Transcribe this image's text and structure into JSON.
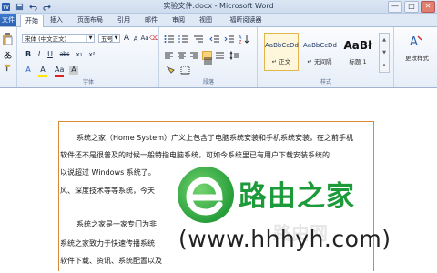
{
  "window": {
    "title": "实验文件.docx - Microsoft Word",
    "controls": [
      "—",
      "□",
      "✕"
    ]
  },
  "quick_access": {
    "icons": [
      "word-icon",
      "save-icon",
      "undo-icon",
      "redo-icon"
    ]
  },
  "tabs": {
    "file": "文件",
    "items": [
      "开始",
      "插入",
      "页面布局",
      "引用",
      "邮件",
      "审阅",
      "视图",
      "福昕阅读器"
    ],
    "active_index": 0
  },
  "ribbon": {
    "font": {
      "name": "宋体 (中文正文)",
      "size": "五号",
      "label": "字体",
      "buttons_row1": [
        "A",
        "A",
        "Aa",
        "⌫",
        "文"
      ],
      "buttons_row2": [
        "B",
        "I",
        "U",
        "abc",
        "x₂",
        "x²"
      ],
      "buttons_row3": [
        "A",
        "A",
        "Aa",
        "A"
      ]
    },
    "paragraph": {
      "label": "段落",
      "alignment_active": "justify"
    },
    "styles": {
      "label": "样式",
      "items": [
        {
          "sample": "AaBbCcDd",
          "name": "↵ 正文",
          "active": true
        },
        {
          "sample": "AaBbCcDd",
          "name": "↵ 无间隔",
          "active": false
        },
        {
          "sample": "AaBł",
          "name": "标题 1",
          "active": false
        }
      ],
      "change_styles": "更改样式",
      "change_styles_icon": "change-styles-icon"
    }
  },
  "document": {
    "lines": [
      "系统之家（Home System）广义上包含了电脑系统安装和手机系统安装，在之前手机",
      "软件还不是很普及的时候一般特指电脑系统，可如今系统里已有用户下载安装系统的",
      "以说超过 Windows 系统了。",
      "风、深度技术等等系统，今天",
      "系统之家是一家专门为非",
      "系统之家致力于快速传播系统",
      "软件下载、资讯、系统配置以及"
    ]
  },
  "watermark": {
    "title": "路由之家",
    "url": "(www.hhhyh.com)",
    "faint": "路由网"
  },
  "colors": {
    "accent": "#2a5fb0",
    "page_border": "#d88a3a",
    "watermark_green": "#1d9a3a"
  }
}
